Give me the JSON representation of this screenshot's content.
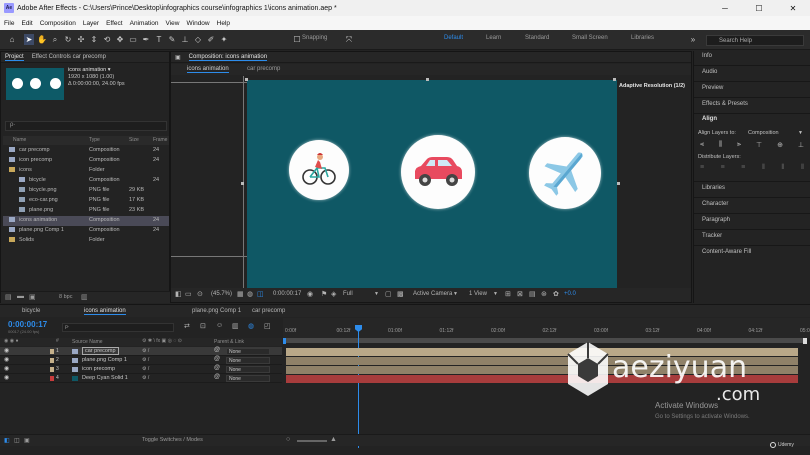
{
  "titlebar": {
    "app_icon": "Ae",
    "title": "Adobe After Effects - C:\\Users\\Prince\\Desktop\\infographics course\\infographics 1\\icons animation.aep *",
    "minimize": "─",
    "maximize": "☐",
    "close": "✕"
  },
  "menu": [
    "File",
    "Edit",
    "Composition",
    "Layer",
    "Effect",
    "Animation",
    "View",
    "Window",
    "Help"
  ],
  "toolbar": {
    "snapping": "Snapping",
    "workspaces": [
      "Default",
      "Learn",
      "Standard",
      "Small Screen",
      "Libraries"
    ],
    "search_placeholder": "Search Help"
  },
  "project": {
    "tabs": [
      "Project",
      "Effect Controls car precomp"
    ],
    "selected_name": "icons animation ▾",
    "selected_info": [
      "1920 x 1080 (1.00)",
      "Δ 0:00:00:00, 24.00 fps"
    ],
    "search_placeholder": "ρ·",
    "columns": [
      "Name",
      "Type",
      "Size",
      "Frame"
    ],
    "items": [
      {
        "name": "car precomp",
        "type": "Composition",
        "size": "",
        "frame": "24",
        "icon": "composition-icon",
        "indent": 0,
        "selected": false
      },
      {
        "name": "icon precomp",
        "type": "Composition",
        "size": "",
        "frame": "24",
        "icon": "composition-icon",
        "indent": 0,
        "selected": false
      },
      {
        "name": "icons",
        "type": "Folder",
        "size": "",
        "frame": "",
        "icon": "folder-icon",
        "indent": 0,
        "selected": false
      },
      {
        "name": "bicycle",
        "type": "Composition",
        "size": "",
        "frame": "24",
        "icon": "composition-icon",
        "indent": 1,
        "selected": false
      },
      {
        "name": "bicycle.png",
        "type": "PNG file",
        "size": "29 KB",
        "frame": "",
        "icon": "png-icon",
        "indent": 1,
        "selected": false
      },
      {
        "name": "eco-car.png",
        "type": "PNG file",
        "size": "17 KB",
        "frame": "",
        "icon": "png-icon",
        "indent": 1,
        "selected": false
      },
      {
        "name": "plane.png",
        "type": "PNG file",
        "size": "23 KB",
        "frame": "",
        "icon": "png-icon",
        "indent": 1,
        "selected": false
      },
      {
        "name": "icons animation",
        "type": "Composition",
        "size": "",
        "frame": "24",
        "icon": "composition-icon",
        "indent": 0,
        "selected": true
      },
      {
        "name": "plane.png Comp 1",
        "type": "Composition",
        "size": "",
        "frame": "24",
        "icon": "composition-icon",
        "indent": 0,
        "selected": false
      },
      {
        "name": "Solids",
        "type": "Folder",
        "size": "",
        "frame": "",
        "icon": "folder-icon",
        "indent": 0,
        "selected": false
      }
    ],
    "bpc": "8 bpc"
  },
  "composition": {
    "tab": "Composition: icons animation",
    "subtabs": [
      "icons animation",
      "car precomp"
    ],
    "adaptive": "Adaptive Resolution (1/2)",
    "zoom": "(45.7%)",
    "timecode": "0:00:00:17",
    "resolution": "Full",
    "camera": "Active Camera",
    "view": "1 View",
    "exposure": "+0.0",
    "bg_color": "#0f5865"
  },
  "rightpanel": {
    "items": [
      "Info",
      "Audio",
      "Preview",
      "Effects & Presets"
    ],
    "align_title": "Align",
    "align_to_label": "Align Layers to:",
    "align_to_value": "Composition",
    "distribute_label": "Distribute Layers:",
    "lower_items": [
      "Libraries",
      "Character",
      "Paragraph",
      "Tracker",
      "Content-Aware Fill"
    ]
  },
  "timeline": {
    "tabs": [
      "bicycle",
      "icons animation",
      "plane.png Comp 1",
      "car precomp"
    ],
    "timecode": "0:00:00:17",
    "timecode_sub": "00017 (24.00 fps)",
    "search_placeholder": "ρ·",
    "col_source": "Source Name",
    "col_parent": "Parent & Link",
    "layers": [
      {
        "num": "1",
        "name": "car precomp",
        "color": "#c6b18b",
        "parent": "None",
        "selected": true
      },
      {
        "num": "2",
        "name": "plane.png Comp 1",
        "color": "#c6b18b",
        "parent": "None",
        "selected": false
      },
      {
        "num": "3",
        "name": "icon precomp",
        "color": "#c6b18b",
        "parent": "None",
        "selected": false
      },
      {
        "num": "4",
        "name": "Deep Cyan Solid 1",
        "color": "#c83c3c",
        "parent": "None",
        "selected": false
      }
    ],
    "ruler_ticks": [
      "0:00f",
      "00:12f",
      "01:00f",
      "01:12f",
      "02:00f",
      "02:12f",
      "03:00f",
      "03:12f",
      "04:00f",
      "04:12f",
      "05:0"
    ],
    "toggle_label": "Toggle Switches / Modes"
  },
  "watermark": {
    "text": "aeziyuan",
    "com": ".com",
    "activate": "Activate Windows",
    "activate_sub": "Go to Settings to activate Windows.",
    "udemy": "Udemy"
  }
}
